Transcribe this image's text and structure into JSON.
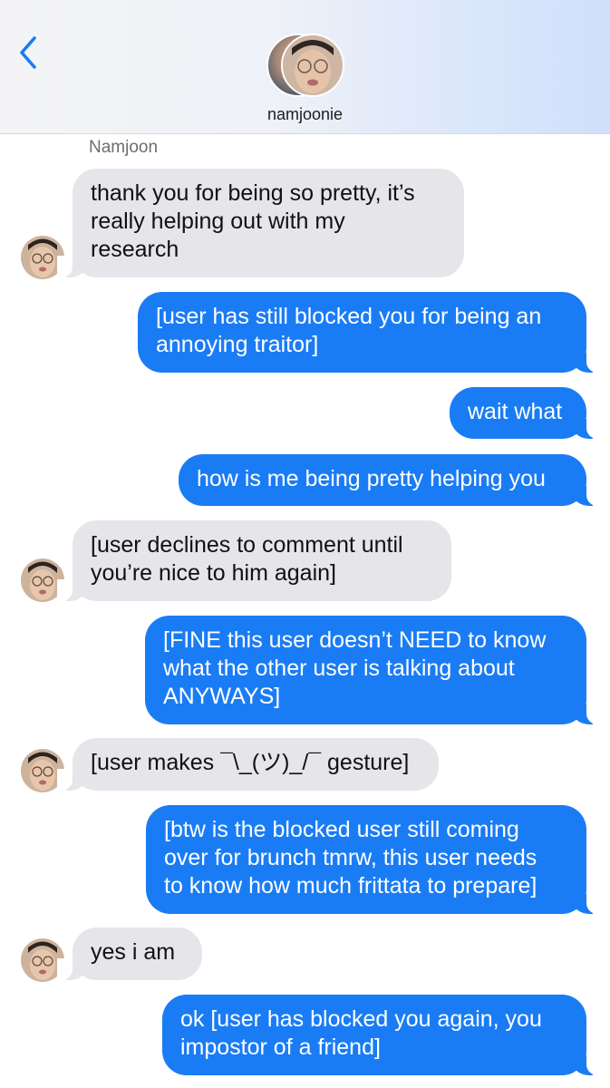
{
  "header": {
    "contact_name": "namjoonie",
    "back_icon": "chevron-left-icon",
    "accent_color": "#1a7cf5"
  },
  "conversation": {
    "sender_label": "Namjoon",
    "messages": [
      {
        "from": "them",
        "lines": [
          "thank you for being so pretty, it’s",
          "really helping out with my",
          "research"
        ]
      },
      {
        "from": "me",
        "lines": [
          "[user has still blocked you for being an",
          "annoying traitor]"
        ]
      },
      {
        "from": "me",
        "lines": [
          "wait what"
        ]
      },
      {
        "from": "me",
        "lines": [
          "how is me being pretty helping you"
        ]
      },
      {
        "from": "them",
        "lines": [
          "[user declines to comment until",
          "you’re nice to him again]"
        ]
      },
      {
        "from": "me",
        "lines": [
          "[FINE this user doesn’t NEED to know",
          "what the other user is talking about",
          "ANYWAYS]"
        ]
      },
      {
        "from": "them",
        "lines": [
          "[user makes ¯\\_(ツ)_/¯ gesture]"
        ]
      },
      {
        "from": "me",
        "lines": [
          "[btw is the blocked user still coming",
          "over for brunch tmrw, this user needs",
          "to know how much frittata to prepare]"
        ]
      },
      {
        "from": "them",
        "lines": [
          "yes i am"
        ]
      },
      {
        "from": "me",
        "lines": [
          "ok [user has blocked you again, you",
          "impostor of a friend]"
        ]
      }
    ]
  },
  "colors": {
    "incoming_bubble": "#e5e5ea",
    "outgoing_bubble": "#1a7cf5"
  }
}
